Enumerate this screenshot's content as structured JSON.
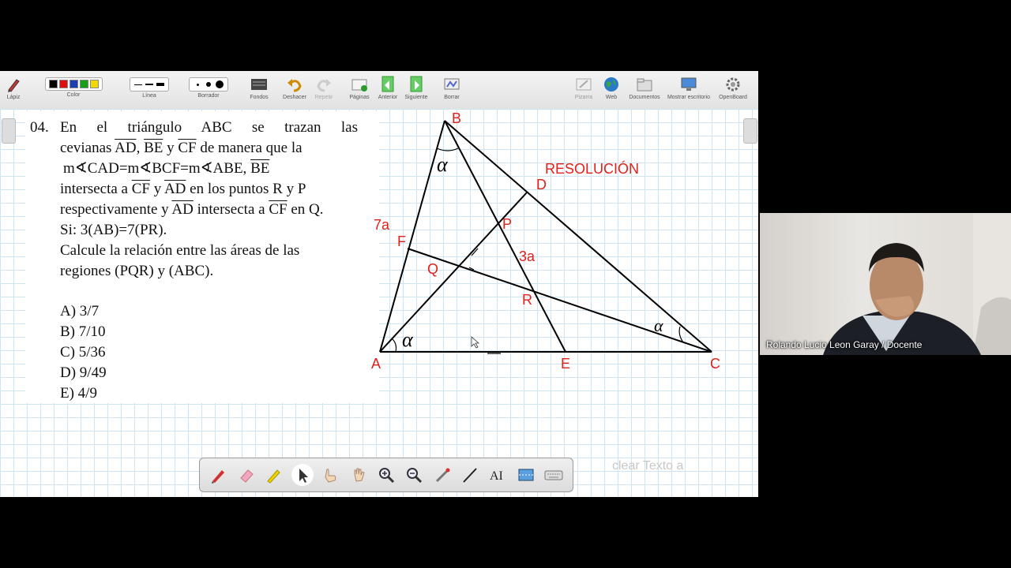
{
  "toolbar": {
    "items": [
      {
        "label": "Lápiz"
      },
      {
        "label": "Color"
      },
      {
        "label": "Línea"
      },
      {
        "label": "Borrador"
      },
      {
        "label": "Fondos"
      },
      {
        "label": "Deshacer"
      },
      {
        "label": "Repetir"
      },
      {
        "label": "Páginas"
      },
      {
        "label": "Anterior"
      },
      {
        "label": "Siguiente"
      },
      {
        "label": "Borrar"
      },
      {
        "label": "Pizarra"
      },
      {
        "label": "Web"
      },
      {
        "label": "Documentos"
      },
      {
        "label": "Mostrar escritorio"
      },
      {
        "label": "OpenBoard"
      }
    ],
    "colors": [
      "#000000",
      "#e01010",
      "#1a3fb0",
      "#18a018",
      "#f0d800"
    ]
  },
  "problem": {
    "number": "04.",
    "line1": "En el triángulo ABC se trazan las",
    "line2a": "cevianas ",
    "ad": "AD",
    "be": "BE",
    "cf": "CF",
    "y": " y ",
    "comma": ", ",
    "line2b": " de manera que la",
    "line3": "m∢CAD=m∢BCF=m∢ABE, ",
    "line4a": "intersecta a ",
    "line4b": " en los puntos R y P",
    "line5a": "respectivamente y ",
    "line5b": " intersecta a ",
    "line5c": " en Q.",
    "line6": "Si: 3(AB)=7(PR).",
    "line7": "Calcule la relación entre las áreas de las",
    "line8": "regiones (PQR) y (ABC).",
    "options": [
      "A) 3/7",
      "B) 7/10",
      "C) 5/36",
      "D) 9/49",
      "E) 4/9"
    ]
  },
  "figure": {
    "title": "RESOLUCIÓN",
    "points": {
      "A": "A",
      "B": "B",
      "C": "C",
      "D": "D",
      "E": "E",
      "F": "F",
      "P": "P",
      "Q": "Q",
      "R": "R"
    },
    "label_7a": "7a",
    "label_3a": "3a",
    "alpha": "α"
  },
  "ghost_text": "clear Texto a",
  "webcam": {
    "name": "Rolando Lucio Leon Garay / Docente"
  },
  "bottom_tools": [
    "pen-tool",
    "eraser-tool",
    "highlighter-tool",
    "select-tool",
    "interact-tool",
    "hand-tool",
    "zoom-in-tool",
    "zoom-out-tool",
    "laser-tool",
    "line-tool",
    "text-tool",
    "capture-tool",
    "keyboard-tool"
  ]
}
